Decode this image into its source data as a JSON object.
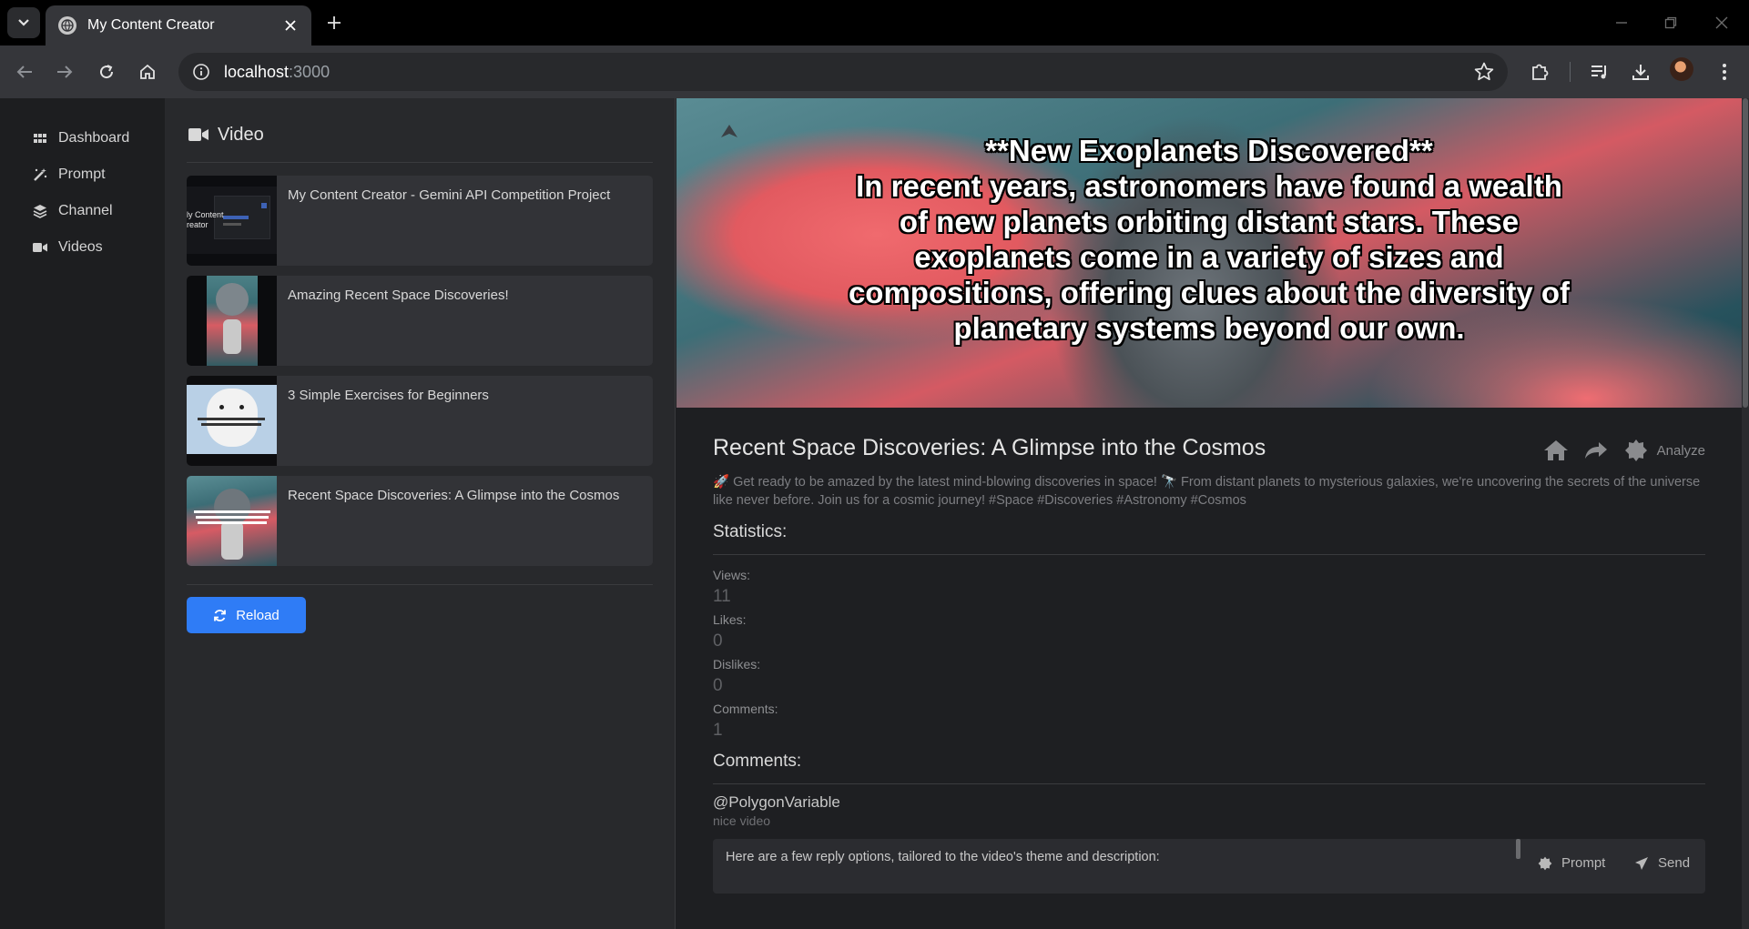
{
  "browser": {
    "tab_title": "My Content Creator",
    "url_host": "localhost",
    "url_port": ":3000"
  },
  "sidebar": {
    "items": [
      {
        "label": "Dashboard",
        "icon": "grid-icon"
      },
      {
        "label": "Prompt",
        "icon": "magic-wand-icon"
      },
      {
        "label": "Channel",
        "icon": "layers-icon"
      },
      {
        "label": "Videos",
        "icon": "video-camera-icon"
      }
    ]
  },
  "list": {
    "header": "Video",
    "videos": [
      {
        "title": "My Content Creator - Gemini API Competition Project",
        "thumb_text": "ly Content\nreator"
      },
      {
        "title": "Amazing Recent Space Discoveries!"
      },
      {
        "title": "3 Simple Exercises for Beginners"
      },
      {
        "title": "Recent Space Discoveries: A Glimpse into the Cosmos"
      }
    ],
    "reload_label": "Reload"
  },
  "detail": {
    "hero_text": "**New Exoplanets Discovered**\nIn recent years, astronomers have found a wealth of new planets orbiting distant stars. These exoplanets come in a variety of sizes and compositions, offering clues about the diversity of planetary systems beyond our own.",
    "title": "Recent Space Discoveries: A Glimpse into the Cosmos",
    "analyze_label": "Analyze",
    "description": "🚀 Get ready to be amazed by the latest mind-blowing discoveries in space! 🔭 From distant planets to mysterious galaxies, we're uncovering the secrets of the universe like never before. Join us for a cosmic journey! #Space #Discoveries #Astronomy #Cosmos",
    "statistics_title": "Statistics:",
    "stats": [
      {
        "label": "Views:",
        "value": "11"
      },
      {
        "label": "Likes:",
        "value": "0"
      },
      {
        "label": "Dislikes:",
        "value": "0"
      },
      {
        "label": "Comments:",
        "value": "1"
      }
    ],
    "comments_title": "Comments:",
    "comment": {
      "author": "@PolygonVariable",
      "text": "nice video"
    },
    "reply_text": "Here are a few reply options, tailored to the video's theme and description:",
    "reply_prompt_label": "Prompt",
    "reply_send_label": "Send"
  },
  "colors": {
    "accent": "#2f7cf6",
    "sidebar_bg": "#1d1e20",
    "pane_bg": "#28292c",
    "card_bg": "#323337"
  }
}
